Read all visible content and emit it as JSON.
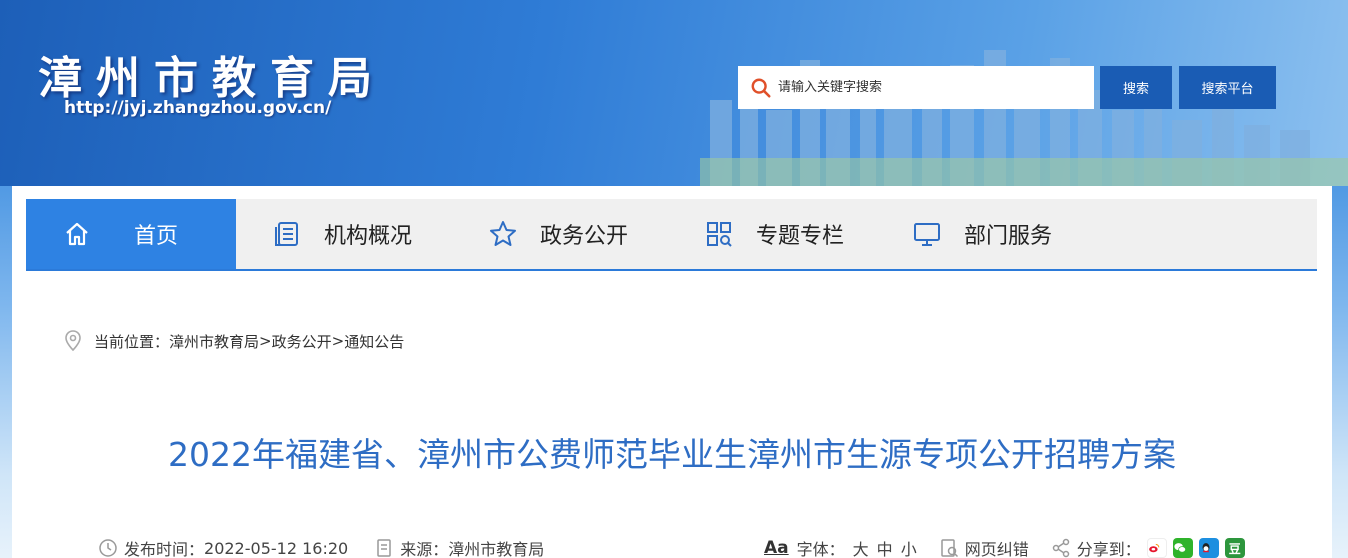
{
  "header": {
    "site_title": "漳州市教育局",
    "site_url": "http://jyj.zhangzhou.gov.cn/",
    "search_placeholder": "请输入关键字搜索",
    "search_button": "搜索",
    "platform_button": "搜索平台"
  },
  "nav": {
    "items": [
      {
        "label": "首页",
        "icon": "home-icon"
      },
      {
        "label": "机构概况",
        "icon": "document-list-icon"
      },
      {
        "label": "政务公开",
        "icon": "star-icon"
      },
      {
        "label": "专题专栏",
        "icon": "grid-search-icon"
      },
      {
        "label": "部门服务",
        "icon": "monitor-icon"
      }
    ]
  },
  "breadcrumb": {
    "prefix": "当前位置：",
    "items": [
      "漳州市教育局",
      "政务公开",
      "通知公告"
    ],
    "separator": ">"
  },
  "article": {
    "title": "2022年福建省、漳州市公费师范毕业生漳州市生源专项公开招聘方案",
    "publish_label": "发布时间：",
    "publish_time": "2022-05-12 16:20",
    "source_label": "来源：",
    "source": "漳州市教育局"
  },
  "tools": {
    "font_icon_text": "Aa",
    "font_label": "字体：",
    "font_large": "大",
    "font_medium": "中",
    "font_small": "小",
    "correction": "网页纠错",
    "share_label": "分享到：",
    "share_targets": [
      "weibo-icon",
      "wechat-icon",
      "qq-icon",
      "douban-icon"
    ],
    "douban_glyph": "豆"
  },
  "colors": {
    "nav_active": "#2e82e3",
    "title_blue": "#2e6dc4",
    "button_blue": "#1a5cb4"
  }
}
